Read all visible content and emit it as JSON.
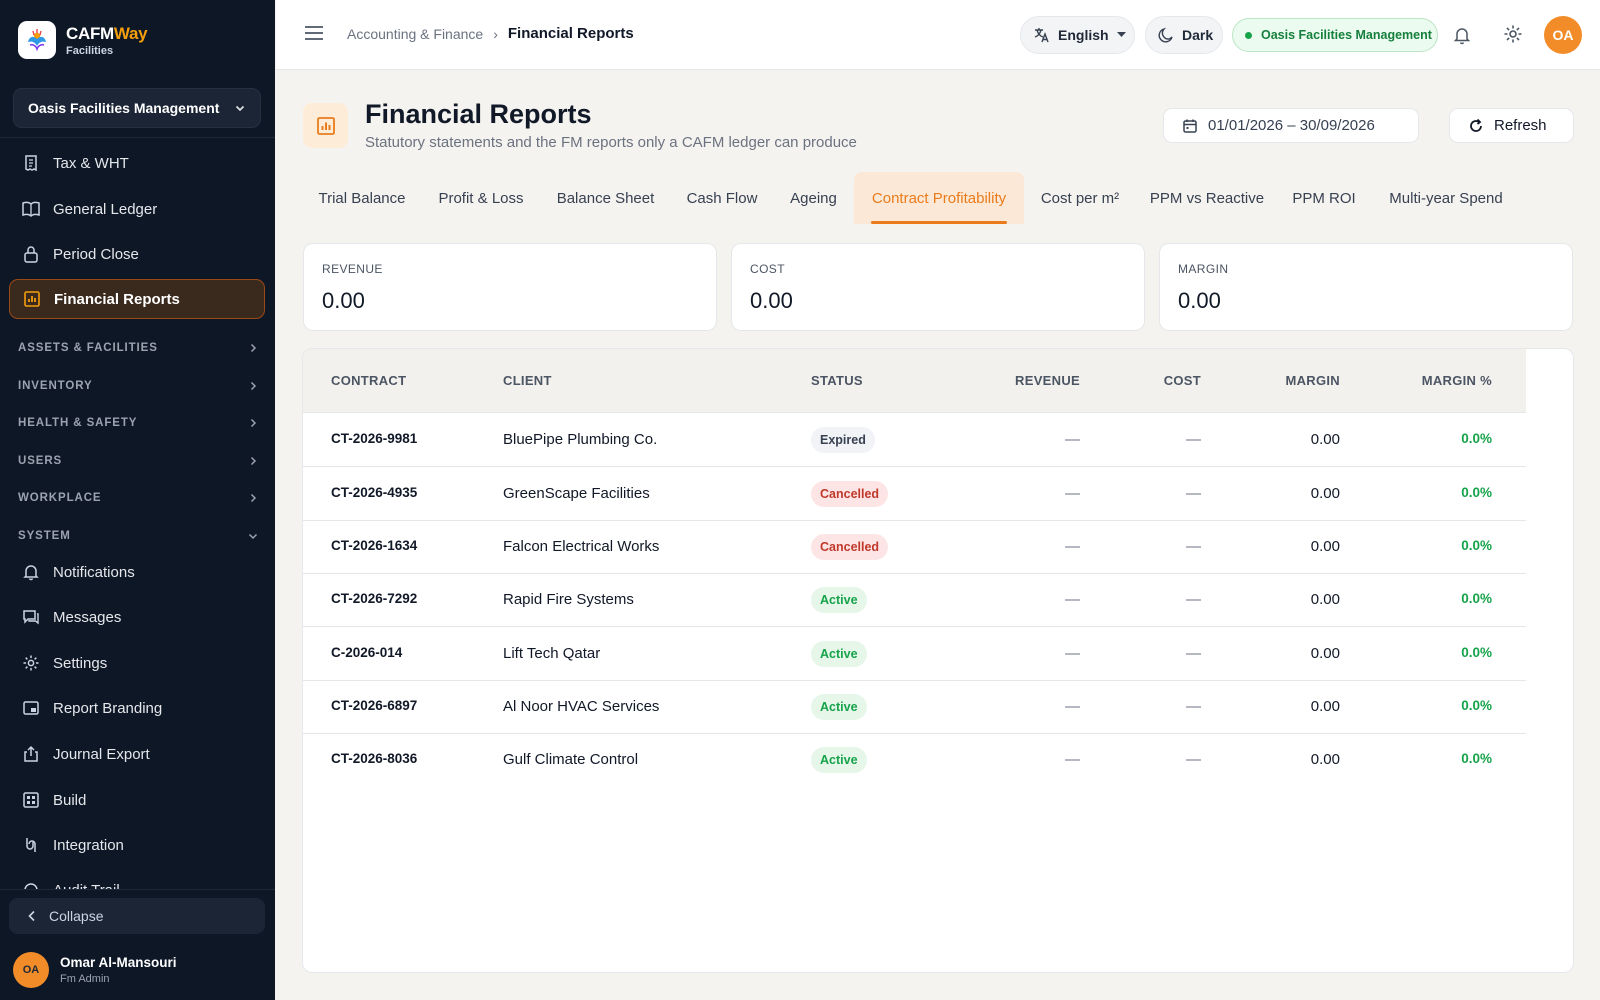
{
  "brand": {
    "name_primary": "CAFM",
    "name_accent": "Way",
    "subtitle": "Facilities"
  },
  "org_selector": {
    "value": "Oasis Facilities Management"
  },
  "sidebar": {
    "items": [
      {
        "label": "Tax & WHT",
        "icon": "receipt-icon"
      },
      {
        "label": "General Ledger",
        "icon": "book-icon"
      },
      {
        "label": "Period Close",
        "icon": "lock-calendar-icon"
      },
      {
        "label": "Financial Reports",
        "icon": "chart-icon",
        "active": true
      }
    ],
    "sections": [
      {
        "label": "ASSETS & FACILITIES",
        "expanded": false
      },
      {
        "label": "INVENTORY",
        "expanded": false
      },
      {
        "label": "HEALTH & SAFETY",
        "expanded": false
      },
      {
        "label": "USERS",
        "expanded": false
      },
      {
        "label": "WORKPLACE",
        "expanded": false
      },
      {
        "label": "SYSTEM",
        "expanded": true
      }
    ],
    "system_items": [
      {
        "label": "Notifications",
        "icon": "bell-icon"
      },
      {
        "label": "Messages",
        "icon": "chat-icon"
      },
      {
        "label": "Settings",
        "icon": "gear-icon"
      },
      {
        "label": "Report Branding",
        "icon": "branding-icon"
      },
      {
        "label": "Journal Export",
        "icon": "export-icon"
      },
      {
        "label": "Build",
        "icon": "build-icon"
      },
      {
        "label": "Integration",
        "icon": "integration-icon"
      },
      {
        "label": "Audit Trail",
        "icon": "audit-icon"
      }
    ],
    "collapse_label": "Collapse",
    "user": {
      "initials": "OA",
      "name": "Omar Al-Mansouri",
      "role": "Fm Admin"
    }
  },
  "topbar": {
    "breadcrumb": [
      "Accounting & Finance",
      "Financial Reports"
    ],
    "language": "English",
    "theme": "Dark",
    "org_status": "Oasis Facilities Management",
    "avatar_initials": "OA"
  },
  "page": {
    "title": "Financial Reports",
    "subtitle": "Statutory statements and the FM reports only a CAFM ledger can produce",
    "date_range": "01/01/2026 – 30/09/2026",
    "refresh_label": "Refresh"
  },
  "tabs": [
    {
      "label": "Trial Balance"
    },
    {
      "label": "Profit & Loss"
    },
    {
      "label": "Balance Sheet"
    },
    {
      "label": "Cash Flow"
    },
    {
      "label": "Ageing"
    },
    {
      "label": "Contract Profitability",
      "active": true
    },
    {
      "label": "Cost per m²"
    },
    {
      "label": "PPM vs Reactive"
    },
    {
      "label": "PPM ROI"
    },
    {
      "label": "Multi-year Spend"
    }
  ],
  "summary": [
    {
      "label": "REVENUE",
      "value": "0.00"
    },
    {
      "label": "COST",
      "value": "0.00"
    },
    {
      "label": "MARGIN",
      "value": "0.00"
    }
  ],
  "table": {
    "columns": [
      "CONTRACT",
      "CLIENT",
      "STATUS",
      "REVENUE",
      "COST",
      "MARGIN",
      "MARGIN %"
    ],
    "rows": [
      {
        "contract": "CT-2026-9981",
        "client": "BluePipe Plumbing Co.",
        "status": "Expired",
        "revenue": "—",
        "cost": "—",
        "margin": "0.00",
        "margin_pct": "0.0%"
      },
      {
        "contract": "CT-2026-4935",
        "client": "GreenScape Facilities",
        "status": "Cancelled",
        "revenue": "—",
        "cost": "—",
        "margin": "0.00",
        "margin_pct": "0.0%"
      },
      {
        "contract": "CT-2026-1634",
        "client": "Falcon Electrical Works",
        "status": "Cancelled",
        "revenue": "—",
        "cost": "—",
        "margin": "0.00",
        "margin_pct": "0.0%"
      },
      {
        "contract": "CT-2026-7292",
        "client": "Rapid Fire Systems",
        "status": "Active",
        "revenue": "—",
        "cost": "—",
        "margin": "0.00",
        "margin_pct": "0.0%"
      },
      {
        "contract": "C-2026-014",
        "client": "Lift Tech Qatar",
        "status": "Active",
        "revenue": "—",
        "cost": "—",
        "margin": "0.00",
        "margin_pct": "0.0%"
      },
      {
        "contract": "CT-2026-6897",
        "client": "Al Noor HVAC Services",
        "status": "Active",
        "revenue": "—",
        "cost": "—",
        "margin": "0.00",
        "margin_pct": "0.0%"
      },
      {
        "contract": "CT-2026-8036",
        "client": "Gulf Climate Control",
        "status": "Active",
        "revenue": "—",
        "cost": "—",
        "margin": "0.00",
        "margin_pct": "0.0%"
      }
    ]
  },
  "colors": {
    "accent": "#ea7c1c",
    "sidebar_bg": "#0d1726",
    "success": "#16a34a",
    "danger": "#c0392b"
  }
}
